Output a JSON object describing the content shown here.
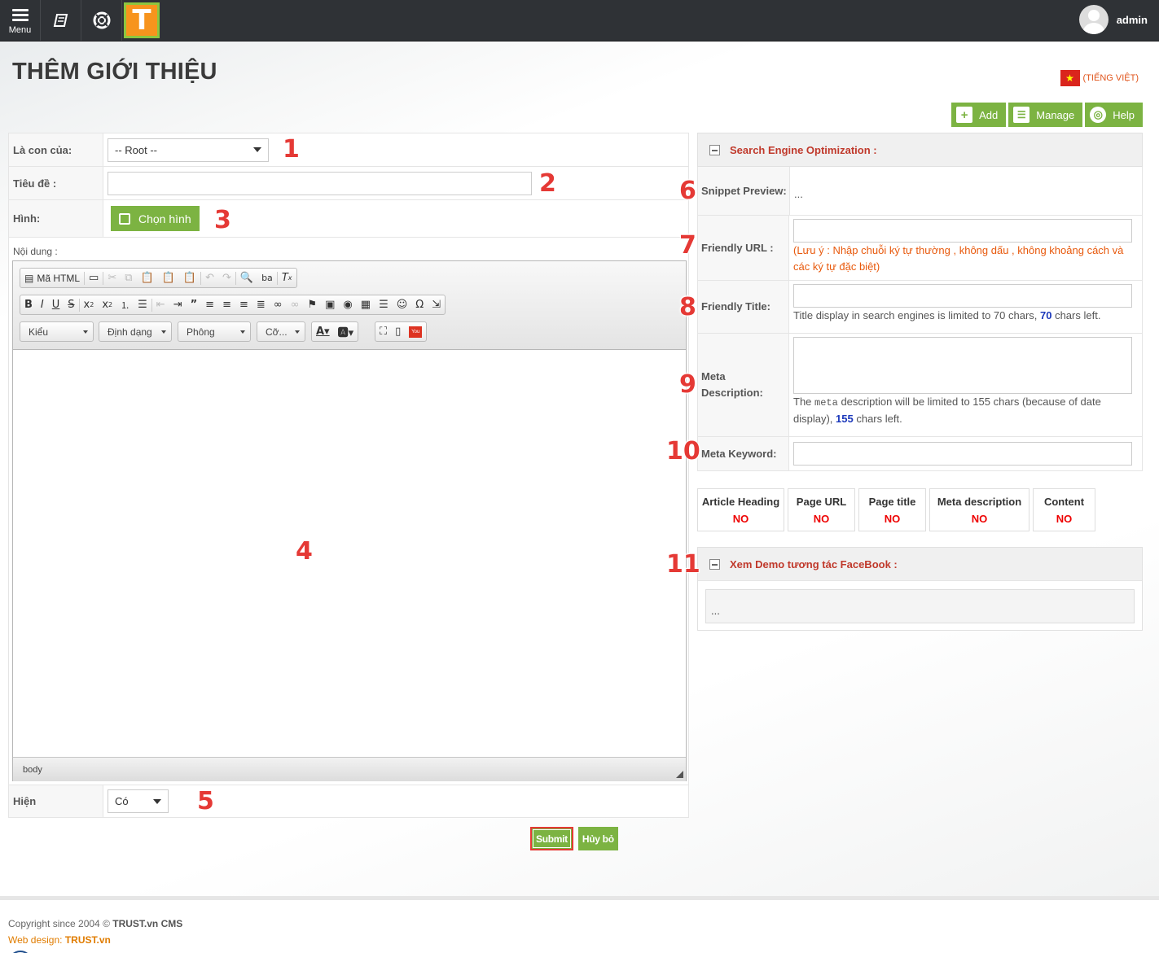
{
  "topbar": {
    "menu_label": "Menu",
    "username": "admin",
    "logo_letter": "T"
  },
  "header": {
    "title": "THÊM GIỚI THIỆU",
    "language": "(TIẾNG VIỆT)"
  },
  "actions": {
    "add": "Add",
    "manage": "Manage",
    "help": "Help"
  },
  "form": {
    "parent_label": "Là con của:",
    "parent_value": "-- Root --",
    "title_label": "Tiêu đề :",
    "title_value": "",
    "image_label": "Hình:",
    "image_button": "Chọn hình",
    "content_label": "Nội dung :",
    "visible_label": "Hiện",
    "visible_value": "Có"
  },
  "editor": {
    "source_label": "Mã HTML",
    "style_combo": "Kiểu",
    "format_combo": "Định dạng",
    "font_combo": "Phông",
    "size_combo": "Cỡ...",
    "path": "body"
  },
  "buttons": {
    "submit": "Submit",
    "cancel": "Hủy bỏ"
  },
  "seo": {
    "title": "Search Engine Optimization :",
    "snippet_label": "Snippet Preview:",
    "snippet_value": "...",
    "url_label": "Friendly URL :",
    "url_note": "(Lưu ý : Nhập chuỗi ký tự thường , không dấu , không khoảng cách và các ký tự đặc biệt)",
    "ftitle_label": "Friendly Title:",
    "ftitle_note_a": "Title display in search engines is limited to 70 chars, ",
    "ftitle_count": "70",
    "ftitle_note_b": " chars left.",
    "meta_label": "Meta Description:",
    "meta_note_a": "The ",
    "meta_note_code": "meta",
    "meta_note_b": " description will be limited to 155 chars (because of date display), ",
    "meta_count": "155",
    "meta_note_c": " chars left.",
    "kw_label": "Meta Keyword:"
  },
  "checks": [
    {
      "label": "Article Heading",
      "status": "NO"
    },
    {
      "label": "Page URL",
      "status": "NO"
    },
    {
      "label": "Page title",
      "status": "NO"
    },
    {
      "label": "Meta description",
      "status": "NO"
    },
    {
      "label": "Content",
      "status": "NO"
    }
  ],
  "facebook": {
    "title": "Xem Demo tương tác FaceBook :",
    "preview": "..."
  },
  "markers": [
    "1",
    "2",
    "3",
    "4",
    "5",
    "6",
    "7",
    "8",
    "9",
    "10",
    "11"
  ],
  "footer": {
    "copyright_prefix": "Copyright since 2004 © ",
    "copyright_brand": "TRUST.vn CMS",
    "design_prefix": "Web design: ",
    "design_brand": "TRUST.vn"
  },
  "colors": {
    "accent_green": "#7cb342",
    "marker_red": "#e53935",
    "topbar": "#2f3236",
    "seo_title": "#c0392b"
  }
}
